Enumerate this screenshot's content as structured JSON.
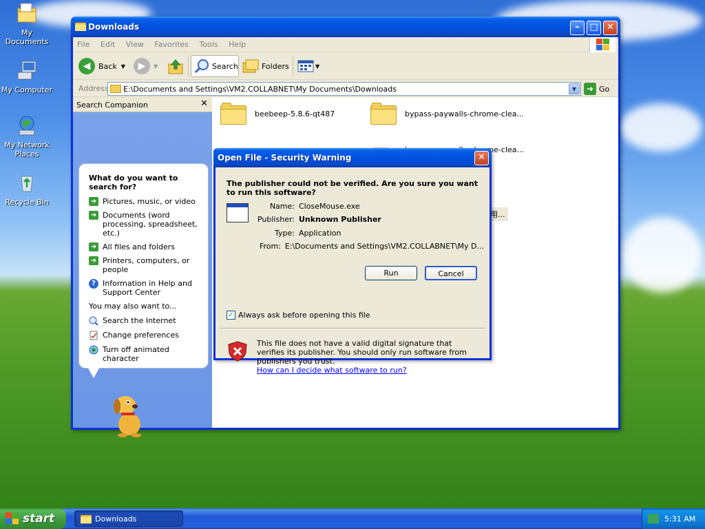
{
  "desktop": {
    "icons": [
      {
        "label": "My Documents",
        "icon": "folder-documents-icon"
      },
      {
        "label": "My Computer",
        "icon": "computer-icon"
      },
      {
        "label": "My Network Places",
        "icon": "network-icon"
      },
      {
        "label": "Recycle Bin",
        "icon": "recycle-bin-icon"
      }
    ]
  },
  "window": {
    "title": "Downloads",
    "menu": [
      "File",
      "Edit",
      "View",
      "Favorites",
      "Tools",
      "Help"
    ],
    "toolbar": {
      "back": "Back",
      "search": "Search",
      "folders": "Folders"
    },
    "address": {
      "label": "Address",
      "value": "E:\\Documents and Settings\\VM2.COLLABNET\\My Documents\\Downloads",
      "go": "Go"
    }
  },
  "companion": {
    "title": "Search Companion",
    "heading": "What do you want to search for?",
    "options": [
      "Pictures, music, or video",
      "Documents (word processing, spreadsheet, etc.)",
      "All files and folders",
      "Printers, computers, or people",
      "Information in Help and Support Center"
    ],
    "also_label": "You may also want to...",
    "also": [
      "Search the Internet",
      "Change preferences",
      "Turn off animated character"
    ]
  },
  "files": [
    {
      "name": "beebeep-5.8.6-qt487",
      "type": "folder"
    },
    {
      "name": "bypass-paywalls-chrome-clea...",
      "type": "folder"
    },
    {
      "name": "bypass-paywalls-chrome-clea...",
      "type": "file"
    },
    {
      "name": "用...",
      "type": "file"
    }
  ],
  "dialog": {
    "title": "Open File - Security Warning",
    "question": "The publisher could not be verified.  Are you sure you want to run this software?",
    "fields": [
      {
        "key": "Name:",
        "value": "CloseMouse.exe",
        "bold": false
      },
      {
        "key": "Publisher:",
        "value": "Unknown Publisher",
        "bold": true
      },
      {
        "key": "Type:",
        "value": "Application",
        "bold": false
      },
      {
        "key": "From:",
        "value": "E:\\Documents and Settings\\VM2.COLLABNET\\My D...",
        "bold": false
      }
    ],
    "run": "Run",
    "cancel": "Cancel",
    "checkbox_label": "Always ask before opening this file",
    "checkbox_checked": true,
    "warning": "This file does not have a valid digital signature that verifies its publisher.  You should only run software from publishers you trust.",
    "link": "How can I decide what software to run?"
  },
  "taskbar": {
    "start": "start",
    "task": "Downloads",
    "time": "5:31 AM"
  },
  "colors": {
    "xp_blue": "#0053e1",
    "start_green": "#3c983c",
    "link": "#0000ff"
  }
}
